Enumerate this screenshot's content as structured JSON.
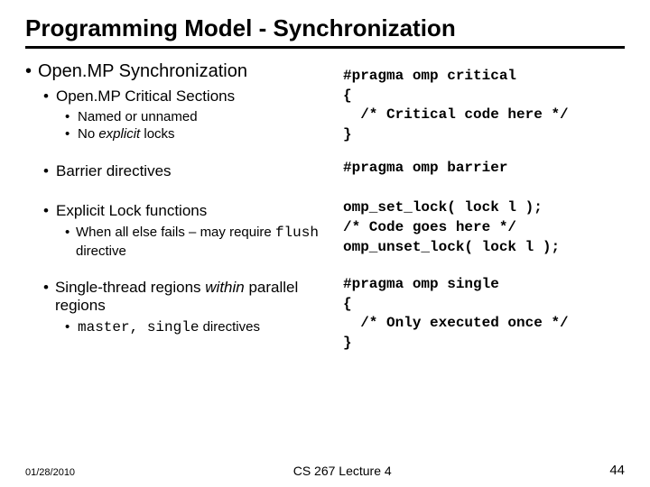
{
  "title": "Programming Model - Synchronization",
  "b1_1": "Open.MP Synchronization",
  "b2_1": "Open.MP Critical Sections",
  "b3_1": "Named or unnamed",
  "b3_2a": "No ",
  "b3_2b": "explicit",
  "b3_2c": " locks",
  "b2_2": "Barrier directives",
  "b2_3": "Explicit Lock functions",
  "b3_3a": "When all else fails – may require ",
  "b3_3b": "flush",
  "b3_3c": " directive",
  "b2_4a": "Single-thread regions ",
  "b2_4b": "within",
  "b2_4c": " parallel regions",
  "b3_4a": "master, single",
  "b3_4b": " directives",
  "code1": "#pragma omp critical\n{\n  /* Critical code here */\n}",
  "code2": "#pragma omp barrier",
  "code3": "omp_set_lock( lock l );\n/* Code goes here */\nomp_unset_lock( lock l );",
  "code4": "#pragma omp single\n{\n  /* Only executed once */\n}",
  "footer": {
    "date": "01/28/2010",
    "center": "CS 267 Lecture 4",
    "pageno": "44"
  }
}
